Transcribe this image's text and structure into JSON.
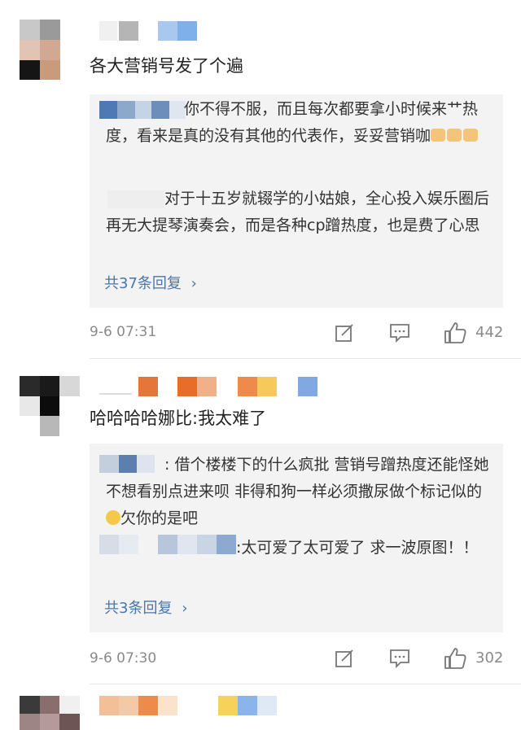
{
  "comments": [
    {
      "text": "各大营销号发了个遍",
      "replies": [
        {
          "name": "",
          "text": "你不得不服，而且每次都要拿小时候来艹热度，看来是真的没有其他的代表作，妥妥营销咖"
        },
        {
          "name": "",
          "text": "对于十五岁就辍学的小姑娘，全心投入娱乐圈后再无大提琴演奏会，而是各种cp蹭热度，也是费了心思"
        }
      ],
      "more_replies": "共37条回复",
      "time": "9-6 07:31",
      "likes": "442"
    },
    {
      "text": "哈哈哈哈娜比:我太难了",
      "replies": [
        {
          "name": "",
          "text": ": 借个楼楼下的什么疯批  营销号蹭热度还能怪她 不想看别点进来呗 非得和狗一样必须撒尿做个标记似的",
          "suffix": "欠你的是吧"
        },
        {
          "name": "",
          "text": ":太可爱了太可爱了  求一波原图！！"
        }
      ],
      "more_replies": "共3条回复",
      "time": "9-6 07:30",
      "likes": "302"
    }
  ],
  "icons": {
    "reply": "edit-icon",
    "comment": "comment-icon",
    "like": "thumbs-up-icon",
    "more_chevron": "chevron-right-icon"
  },
  "colors": {
    "link": "#4a76a8",
    "meta": "#8a8a8a",
    "reply_bg": "#f3f3f3"
  }
}
